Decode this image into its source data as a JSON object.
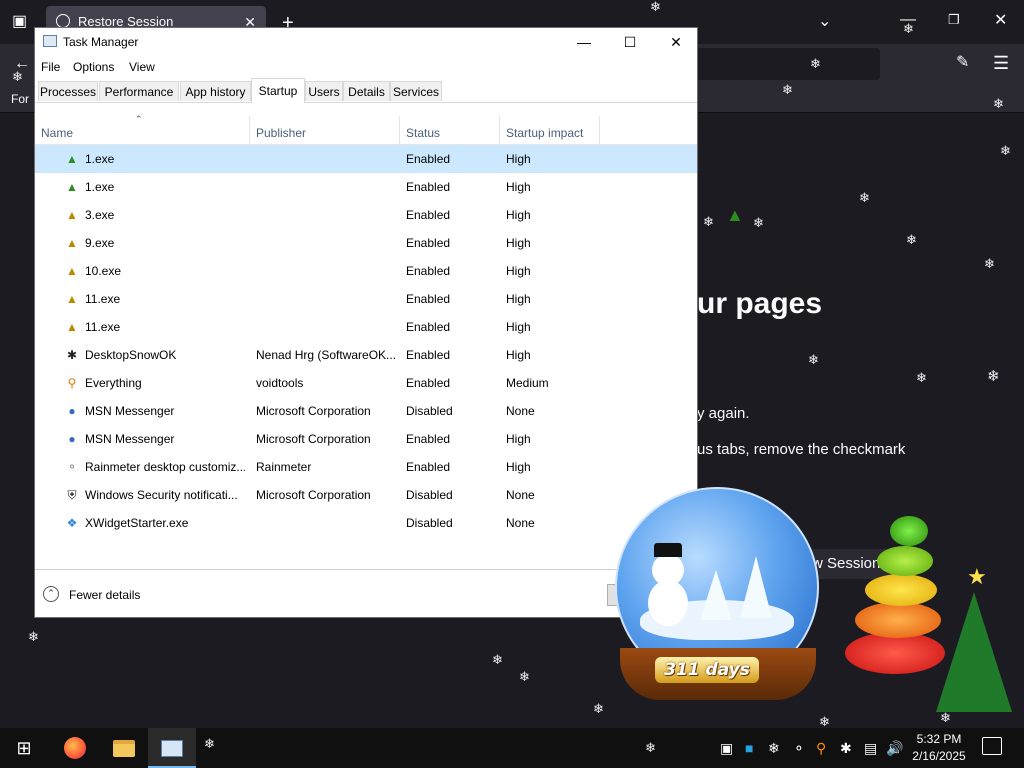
{
  "firefox": {
    "tab_title": "Restore Session",
    "partial_nav_text": "For",
    "heading_partial": "ur pages",
    "line1_partial": "y again.",
    "line2_partial": "us tabs, remove the checkmark",
    "button_partial": "w Session"
  },
  "taskmanager": {
    "title": "Task Manager",
    "menu": [
      "File",
      "Options",
      "View"
    ],
    "tabs": [
      "Processes",
      "Performance",
      "App history",
      "Startup",
      "Users",
      "Details",
      "Services"
    ],
    "active_tab": "Startup",
    "columns": [
      "Name",
      "Publisher",
      "Status",
      "Startup impact"
    ],
    "rows": [
      {
        "name": "1.exe",
        "publisher": "",
        "status": "Enabled",
        "impact": "High",
        "icon": "tree-icon"
      },
      {
        "name": "1.exe",
        "publisher": "",
        "status": "Enabled",
        "impact": "High",
        "icon": "tree-icon"
      },
      {
        "name": "3.exe",
        "publisher": "",
        "status": "Enabled",
        "impact": "High",
        "icon": "tree-icon"
      },
      {
        "name": "9.exe",
        "publisher": "",
        "status": "Enabled",
        "impact": "High",
        "icon": "tree-icon"
      },
      {
        "name": "10.exe",
        "publisher": "",
        "status": "Enabled",
        "impact": "High",
        "icon": "tree-icon"
      },
      {
        "name": "11.exe",
        "publisher": "",
        "status": "Enabled",
        "impact": "High",
        "icon": "tree-icon"
      },
      {
        "name": "11.exe",
        "publisher": "",
        "status": "Enabled",
        "impact": "High",
        "icon": "tree-icon"
      },
      {
        "name": "DesktopSnowOK",
        "publisher": "Nenad Hrg (SoftwareOK...",
        "status": "Enabled",
        "impact": "High",
        "icon": "snowflake-icon"
      },
      {
        "name": "Everything",
        "publisher": "voidtools",
        "status": "Enabled",
        "impact": "Medium",
        "icon": "search-icon"
      },
      {
        "name": "MSN Messenger",
        "publisher": "Microsoft Corporation",
        "status": "Disabled",
        "impact": "None",
        "icon": "messenger-icon"
      },
      {
        "name": "MSN Messenger",
        "publisher": "Microsoft Corporation",
        "status": "Enabled",
        "impact": "High",
        "icon": "messenger-icon"
      },
      {
        "name": "Rainmeter desktop customiz...",
        "publisher": "Rainmeter",
        "status": "Enabled",
        "impact": "High",
        "icon": "drop-icon"
      },
      {
        "name": "Windows Security notificati...",
        "publisher": "Microsoft Corporation",
        "status": "Disabled",
        "impact": "None",
        "icon": "shield-icon"
      },
      {
        "name": "XWidgetStarter.exe",
        "publisher": "",
        "status": "Disabled",
        "impact": "None",
        "icon": "widget-icon"
      }
    ],
    "footer_label": "Fewer details"
  },
  "snowglobe": {
    "label": "311 days"
  },
  "taskbar": {
    "time": "5:32 PM",
    "date": "2/16/2025"
  }
}
